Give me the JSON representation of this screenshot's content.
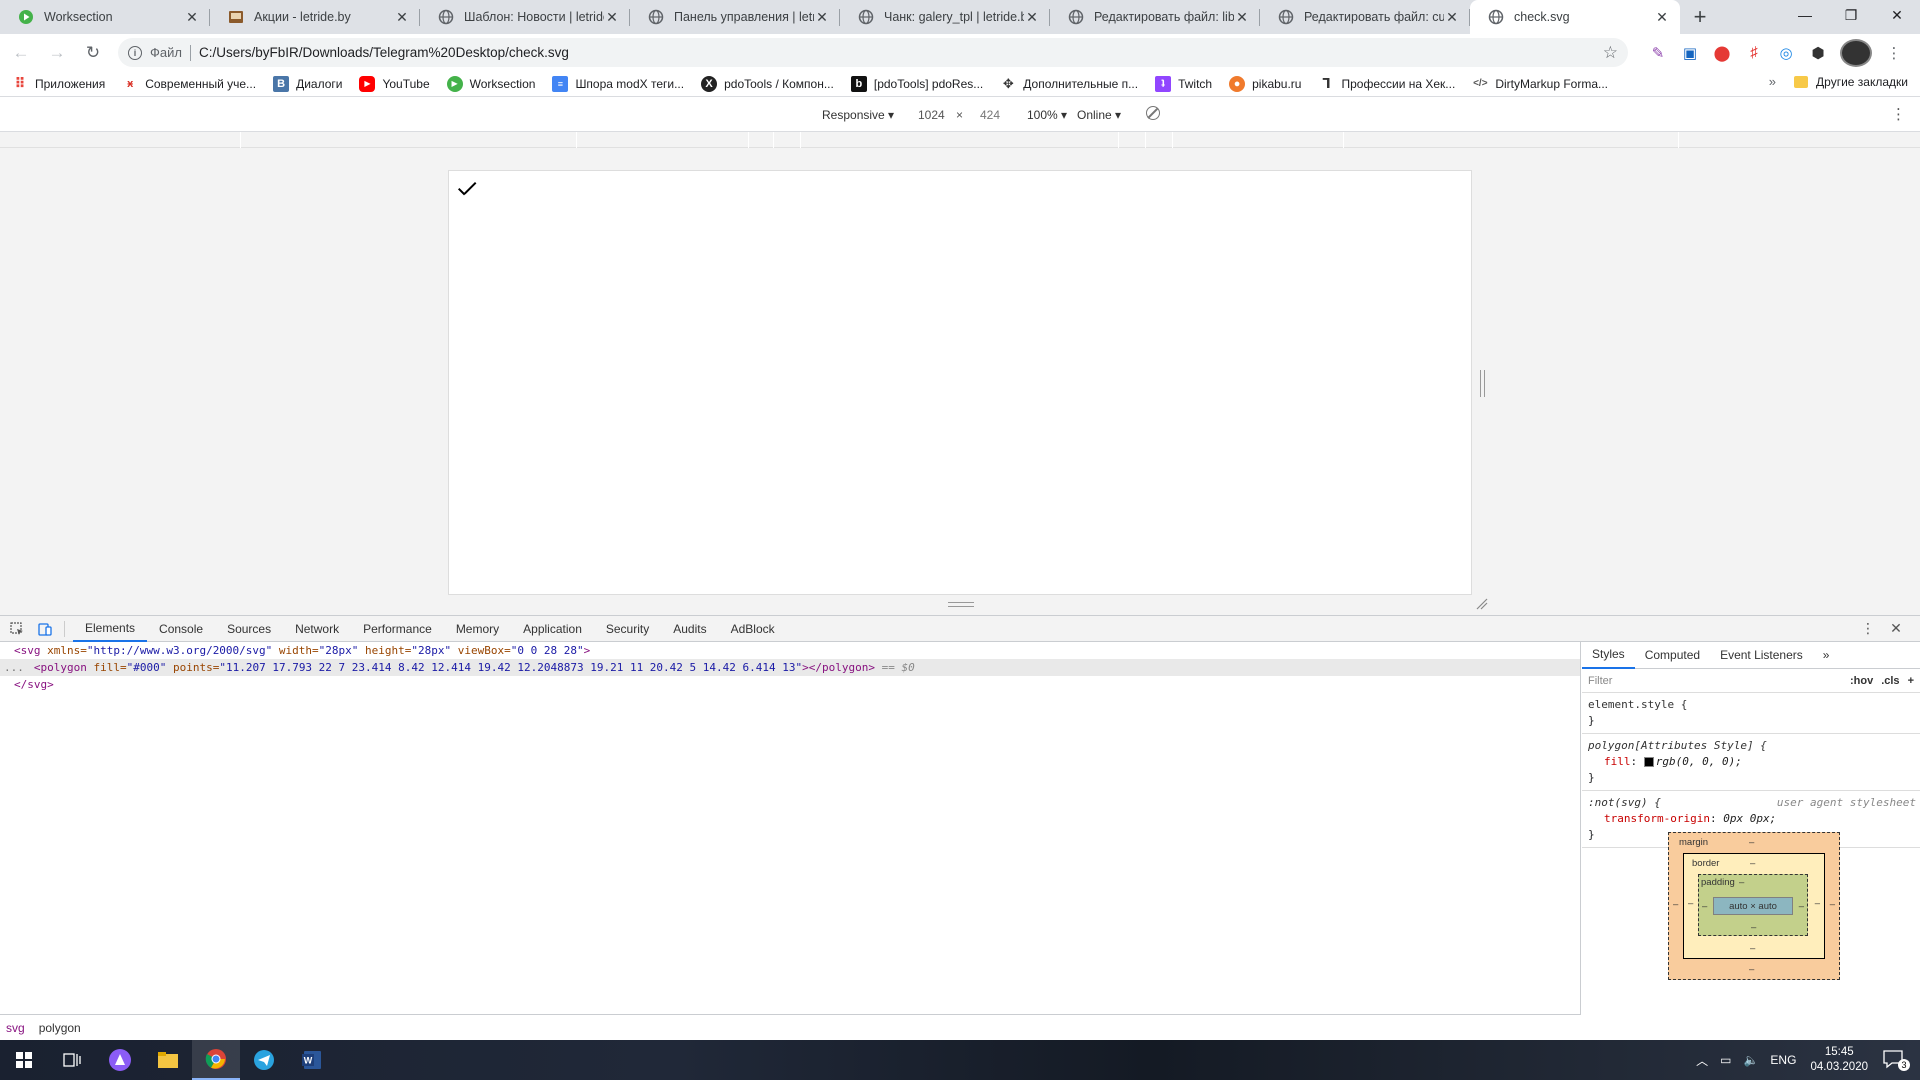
{
  "browser": {
    "tabs": [
      {
        "title": "Worksection",
        "icon": "worksection-icon",
        "color": "#44b24a"
      },
      {
        "title": "Акции - letride.by",
        "icon": "page-icon",
        "color": "#8b5a2b"
      },
      {
        "title": "Шаблон: Новости | letride.b",
        "icon": "globe-icon",
        "color": "#5f6368"
      },
      {
        "title": "Панель управления | letride",
        "icon": "globe-icon",
        "color": "#5f6368"
      },
      {
        "title": "Чанк: galery_tpl | letride.by",
        "icon": "globe-icon",
        "color": "#5f6368"
      },
      {
        "title": "Редактировать файл: libs.js",
        "icon": "globe-icon",
        "color": "#5f6368"
      },
      {
        "title": "Редактировать файл: custo",
        "icon": "globe-icon",
        "color": "#5f6368"
      },
      {
        "title": "check.svg",
        "icon": "globe-icon",
        "color": "#5f6368",
        "active": true
      }
    ],
    "address": {
      "scheme_label": "Файл",
      "url": "C:/Users/byFbIR/Downloads/Telegram%20Desktop/check.svg"
    },
    "bookmarks": [
      {
        "label": "Приложения",
        "icon": "apps-grid-icon",
        "color": "#e8453c"
      },
      {
        "label": "Современный уче...",
        "icon": "figure-icon",
        "color": "#d93025"
      },
      {
        "label": "Диалоги",
        "icon": "vk-icon",
        "color": "#4a76a8"
      },
      {
        "label": "YouTube",
        "icon": "youtube-icon",
        "color": "#ff0000"
      },
      {
        "label": "Worksection",
        "icon": "worksection-icon",
        "color": "#44b24a"
      },
      {
        "label": "Шпора modX теги...",
        "icon": "doc-icon",
        "color": "#4285f4"
      },
      {
        "label": "pdoTools / Компон...",
        "icon": "x-icon",
        "color": "#222222"
      },
      {
        "label": "[pdoTools] pdoRes...",
        "icon": "b-icon",
        "color": "#111111"
      },
      {
        "label": "Дополнительные п...",
        "icon": "puzzle-icon",
        "color": "#333333"
      },
      {
        "label": "Twitch",
        "icon": "twitch-icon",
        "color": "#9146ff"
      },
      {
        "label": "pikabu.ru",
        "icon": "pikabu-icon",
        "color": "#f07a2c"
      },
      {
        "label": "Профессии на Хек...",
        "icon": "person-icon",
        "color": "#333333"
      },
      {
        "label": "DirtyMarkup Forma...",
        "icon": "code-icon",
        "color": "#555555"
      }
    ],
    "bookmarks_more": "»",
    "other_bookmarks": "Другие закладки"
  },
  "device_toolbar": {
    "mode": "Responsive",
    "width": "1024",
    "times": "×",
    "height": "424",
    "zoom": "100%",
    "network": "Online"
  },
  "devtools": {
    "tabs": [
      "Elements",
      "Console",
      "Sources",
      "Network",
      "Performance",
      "Memory",
      "Application",
      "Security",
      "Audits",
      "AdBlock"
    ],
    "active_tab": "Elements",
    "code": {
      "line1": {
        "open": "<svg",
        "a1": " xmlns=",
        "v1": "\"http://www.w3.org/2000/svg\"",
        "a2": " width=",
        "v2": "\"28px\"",
        "a3": " height=",
        "v3": "\"28px\"",
        "a4": " viewBox=",
        "v4": "\"0 0 28 28\"",
        "close": ">"
      },
      "line2": {
        "dots": "...",
        "open": "<polygon",
        "a1": " fill=",
        "v1": "\"#000\"",
        "a2": " points=",
        "v2": "\"11.207 17.793 22 7 23.414 8.42 12.414 19.42 12.2048873 19.21 11 20.42 5 14.42 6.414 13\"",
        "close": "></polygon>",
        "eq": " == $0"
      },
      "line3": "</svg>"
    },
    "breadcrumbs": [
      "svg",
      "polygon"
    ],
    "styles": {
      "tabs": [
        "Styles",
        "Computed",
        "Event Listeners",
        "»"
      ],
      "filter_placeholder": "Filter",
      "hov": ":hov",
      "cls": ".cls",
      "plus": "+",
      "rule1": {
        "selector": "element.style {",
        "close": "}"
      },
      "rule2": {
        "selector": "polygon[Attributes Style] {",
        "prop": "fill",
        "value": "rgb(0, 0, 0);",
        "close": "}"
      },
      "rule3": {
        "selector": ":not(svg) {",
        "origin": "user agent stylesheet",
        "prop": "transform-origin",
        "value": "0px 0px;",
        "close": "}"
      },
      "box": {
        "margin": "margin",
        "border": "border",
        "padding": "padding",
        "content": "auto × auto",
        "dash": "–"
      }
    }
  },
  "taskbar": {
    "language": "ENG",
    "time": "15:45",
    "date": "04.03.2020",
    "notifications": "3"
  }
}
